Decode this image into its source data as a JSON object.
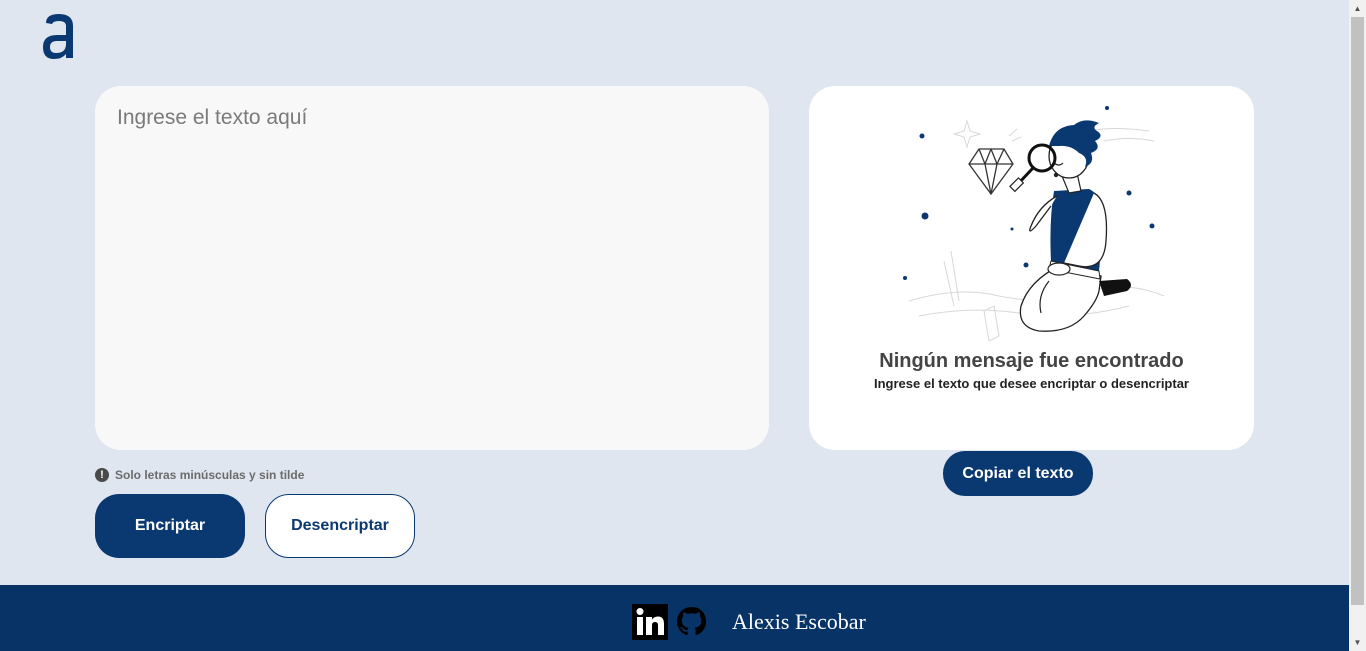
{
  "header": {
    "logo_icon": "alura-a-logo-icon"
  },
  "input": {
    "placeholder": "Ingrese el texto aquí",
    "value": ""
  },
  "hint": {
    "icon": "exclamation-circle-icon",
    "text": "Solo letras minúsculas y sin tilde"
  },
  "actions": {
    "encrypt_label": "Encriptar",
    "decrypt_label": "Desencriptar"
  },
  "output": {
    "illustration": "person-with-magnifier-illustration",
    "empty_title": "Ningún mensaje fue encontrado",
    "empty_subtitle": "Ingrese el texto que desee encriptar o desencriptar",
    "copy_label": "Copiar el texto"
  },
  "footer": {
    "linkedin_icon": "linkedin-icon",
    "github_icon": "github-icon",
    "name": "Alexis Escobar"
  },
  "colors": {
    "background": "#e0e6ef",
    "primary": "#0a3871",
    "footer": "#073366",
    "card": "#f8f8f9"
  }
}
